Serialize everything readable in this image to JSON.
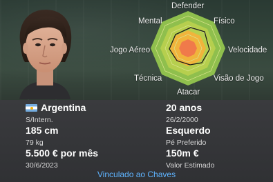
{
  "radar": {
    "labels": {
      "defender": "Defender",
      "mental": "Mental",
      "fisico": "Físico",
      "jogo_aereo": "Jogo Aéreo",
      "velocidade": "Velocidade",
      "tecnica": "Técnica",
      "visao": "Visão de Jogo",
      "atacar": "Atacar"
    },
    "colors": {
      "outer": "#8fbf4d",
      "mid": "#b6cf4e",
      "inner": "#f0b43c",
      "core": "#f07a4a",
      "rings": "#d8e38a",
      "profile": "#1a1a1a"
    }
  },
  "player": {
    "nationality": "Argentina",
    "intl_status": "S/Intern.",
    "height": "185 cm",
    "weight": "79 kg",
    "wage": "5.500 € por mês",
    "contract_end": "30/6/2023",
    "age": "20 anos",
    "dob": "26/2/2000",
    "preferred_foot": "Esquerdo",
    "preferred_foot_label": "Pé Preferido",
    "value": "150m €",
    "value_label": "Valor Estimado",
    "contract_link": "Vinculado ao Chaves"
  }
}
